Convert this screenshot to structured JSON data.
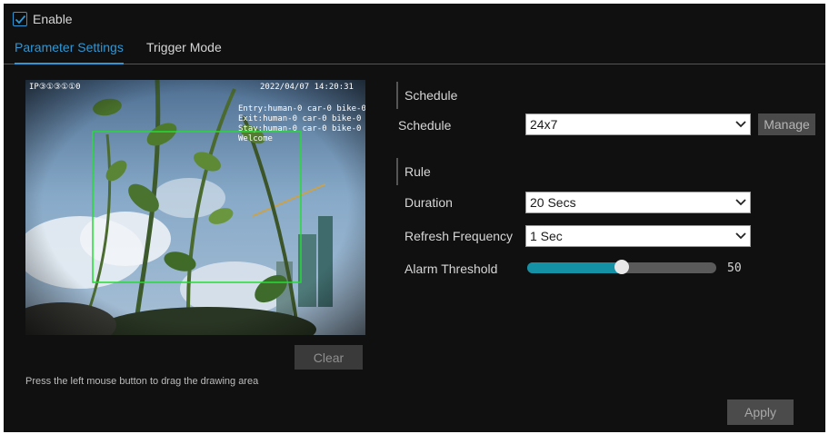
{
  "enable": {
    "label": "Enable",
    "checked": true
  },
  "tabs": [
    {
      "label": "Parameter Settings",
      "active": true
    },
    {
      "label": "Trigger Mode",
      "active": false
    }
  ],
  "video": {
    "osd_channel": "IP③①③①①0",
    "osd_timestamp": "2022/04/07 14:20:31",
    "osd_lines": [
      "Entry:human-0 car-0 bike-0",
      "Exit:human-0 car-0 bike-0",
      "Stay:human-0 car-0 bike-0",
      "Welcome"
    ]
  },
  "clear_label": "Clear",
  "hint": "Press the left mouse button to drag the drawing area",
  "schedule_section": {
    "title": "Schedule",
    "label": "Schedule",
    "value": "24x7",
    "manage_label": "Manage"
  },
  "rule_section": {
    "title": "Rule",
    "duration_label": "Duration",
    "duration_value": "20 Secs",
    "refresh_label": "Refresh Frequency",
    "refresh_value": "1 Sec",
    "threshold_label": "Alarm Threshold",
    "threshold_value": "50",
    "threshold_fraction": 0.5
  },
  "apply_label": "Apply",
  "colors": {
    "accent": "#2f97d6",
    "slider_fill": "#1591a6",
    "roi_box": "#22dd33"
  }
}
